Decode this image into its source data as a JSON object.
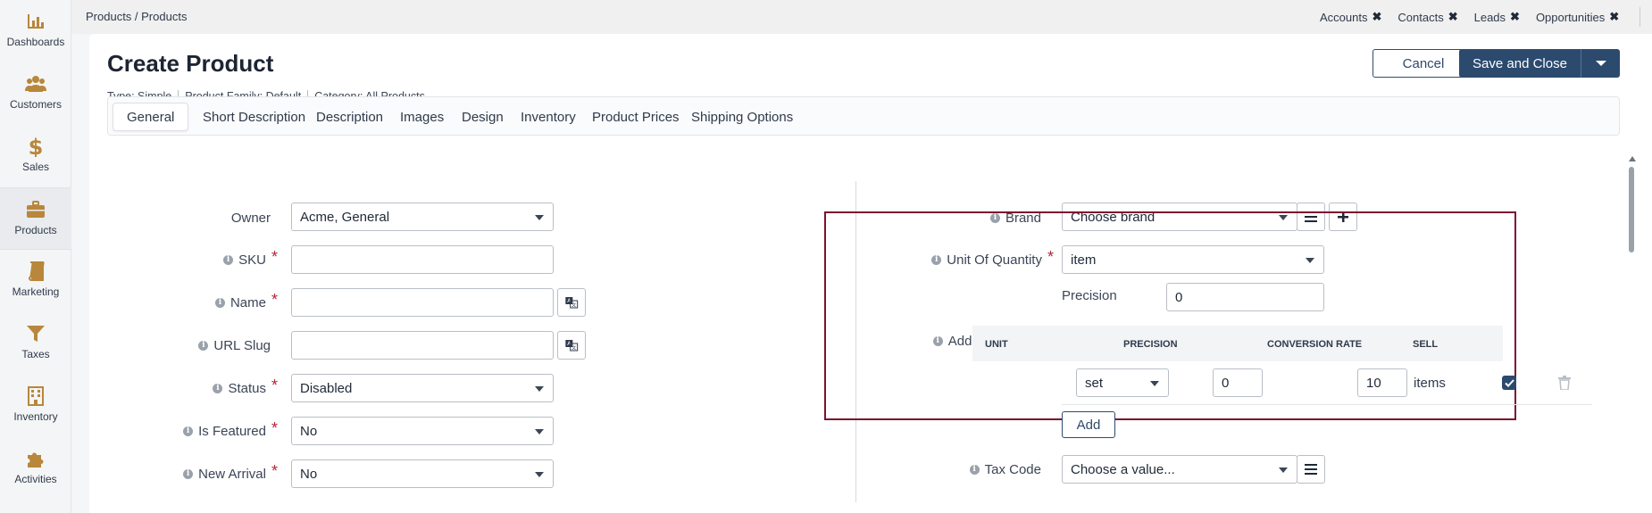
{
  "sidebar": {
    "items": [
      {
        "label": "Dashboards",
        "icon": "bar-chart-icon"
      },
      {
        "label": "Customers",
        "icon": "users-icon"
      },
      {
        "label": "Sales",
        "icon": "dollar-icon"
      },
      {
        "label": "Products",
        "icon": "briefcase-icon",
        "active": true
      },
      {
        "label": "Marketing",
        "icon": "book-icon"
      },
      {
        "label": "Taxes",
        "icon": "funnel-icon"
      },
      {
        "label": "Inventory",
        "icon": "building-icon"
      },
      {
        "label": "Activities",
        "icon": "puzzle-icon"
      }
    ]
  },
  "topbar": {
    "breadcrumb": "Products / Products",
    "pins": [
      "Accounts",
      "Contacts",
      "Leads",
      "Opportunities"
    ]
  },
  "page": {
    "title": "Create Product",
    "meta": [
      "Type: Simple",
      "Product Family: Default",
      "Category: All Products"
    ],
    "cancel_label": "Cancel",
    "save_label": "Save and Close"
  },
  "tabs": [
    "General",
    "Short Description",
    "Description",
    "Images",
    "Design",
    "Inventory",
    "Product Prices",
    "Shipping Options"
  ],
  "left_form": {
    "owner_label": "Owner",
    "owner_value": "Acme, General",
    "sku_label": "SKU",
    "sku_value": "",
    "name_label": "Name",
    "name_value": "",
    "slug_label": "URL Slug",
    "slug_value": "",
    "status_label": "Status",
    "status_value": "Disabled",
    "featured_label": "Is Featured",
    "featured_value": "No",
    "arrival_label": "New Arrival",
    "arrival_value": "No"
  },
  "right_form": {
    "brand_label": "Brand",
    "brand_value": "Choose brand",
    "uoq_label": "Unit Of Quantity",
    "uoq_value": "item",
    "precision_label": "Precision",
    "precision_value": "0",
    "additional_units_label": "Additional Units",
    "units_table": {
      "headers": [
        "UNIT",
        "PRECISION",
        "CONVERSION RATE",
        "SELL"
      ],
      "row": {
        "unit": "set",
        "precision": "0",
        "rate": "10",
        "rate_suffix": "items",
        "sell": true
      }
    },
    "add_label": "Add",
    "tax_label": "Tax Code",
    "tax_value": "Choose a value..."
  },
  "colors": {
    "accent": "#2c4a6e",
    "highlight_border": "#7d1230",
    "icon_gold": "#b8873b",
    "required": "#b5243a"
  }
}
